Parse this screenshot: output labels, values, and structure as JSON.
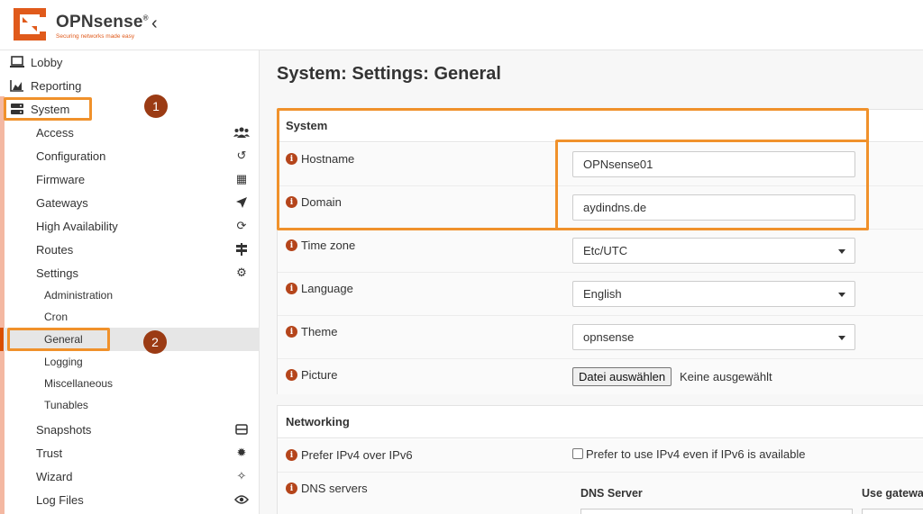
{
  "brand": {
    "name": "OPNsense",
    "registered": "®",
    "tagline": "Securing networks made easy",
    "color": "#e05a1b"
  },
  "header": {
    "collapse_icon": "chevron-left-icon",
    "collapse_glyph": "‹"
  },
  "sidebar": {
    "top_items": [
      {
        "label": "Lobby",
        "icon": "laptop-icon"
      },
      {
        "label": "Reporting",
        "icon": "area-chart-icon"
      },
      {
        "label": "System",
        "icon": "server-icon"
      }
    ],
    "system_items": [
      {
        "label": "Access",
        "icon": "users-icon",
        "glyph": "👥"
      },
      {
        "label": "Configuration",
        "icon": "history-icon",
        "glyph": "↺"
      },
      {
        "label": "Firmware",
        "icon": "building-icon",
        "glyph": "▦"
      },
      {
        "label": "Gateways",
        "icon": "location-arrow-icon",
        "glyph": "➤"
      },
      {
        "label": "High Availability",
        "icon": "refresh-icon",
        "glyph": "⟳"
      },
      {
        "label": "Routes",
        "icon": "map-signs-icon",
        "glyph": "⇆"
      },
      {
        "label": "Settings",
        "icon": "cogs-icon",
        "glyph": "⚙"
      }
    ],
    "settings_items": [
      {
        "label": "Administration"
      },
      {
        "label": "Cron"
      },
      {
        "label": "General"
      },
      {
        "label": "Logging"
      },
      {
        "label": "Miscellaneous"
      },
      {
        "label": "Tunables"
      }
    ],
    "bottom_items": [
      {
        "label": "Snapshots",
        "icon": "hdd-icon",
        "glyph": "▭"
      },
      {
        "label": "Trust",
        "icon": "certificate-icon",
        "glyph": "✹"
      },
      {
        "label": "Wizard",
        "icon": "magic-icon",
        "glyph": "✧"
      },
      {
        "label": "Log Files",
        "icon": "eye-icon",
        "glyph": "◉"
      }
    ]
  },
  "callouts": {
    "badge1": "1",
    "badge2": "2",
    "color": "#f0912b"
  },
  "main": {
    "title": "System: Settings: General",
    "system_section": {
      "heading": "System",
      "hostname_label": "Hostname",
      "hostname_value": "OPNsense01",
      "domain_label": "Domain",
      "domain_value": "aydindns.de",
      "timezone_label": "Time zone",
      "timezone_value": "Etc/UTC",
      "language_label": "Language",
      "language_value": "English",
      "theme_label": "Theme",
      "theme_value": "opnsense",
      "picture_label": "Picture",
      "picture_button": "Datei auswählen",
      "picture_none": "Keine ausgewählt"
    },
    "networking_section": {
      "heading": "Networking",
      "prefer_label": "Prefer IPv4 over IPv6",
      "prefer_checkbox_label": "Prefer to use IPv4 even if IPv6 is available",
      "prefer_checked": false,
      "dns_label": "DNS servers",
      "dns_col_server": "DNS Server",
      "dns_col_gateway": "Use gateway"
    }
  }
}
